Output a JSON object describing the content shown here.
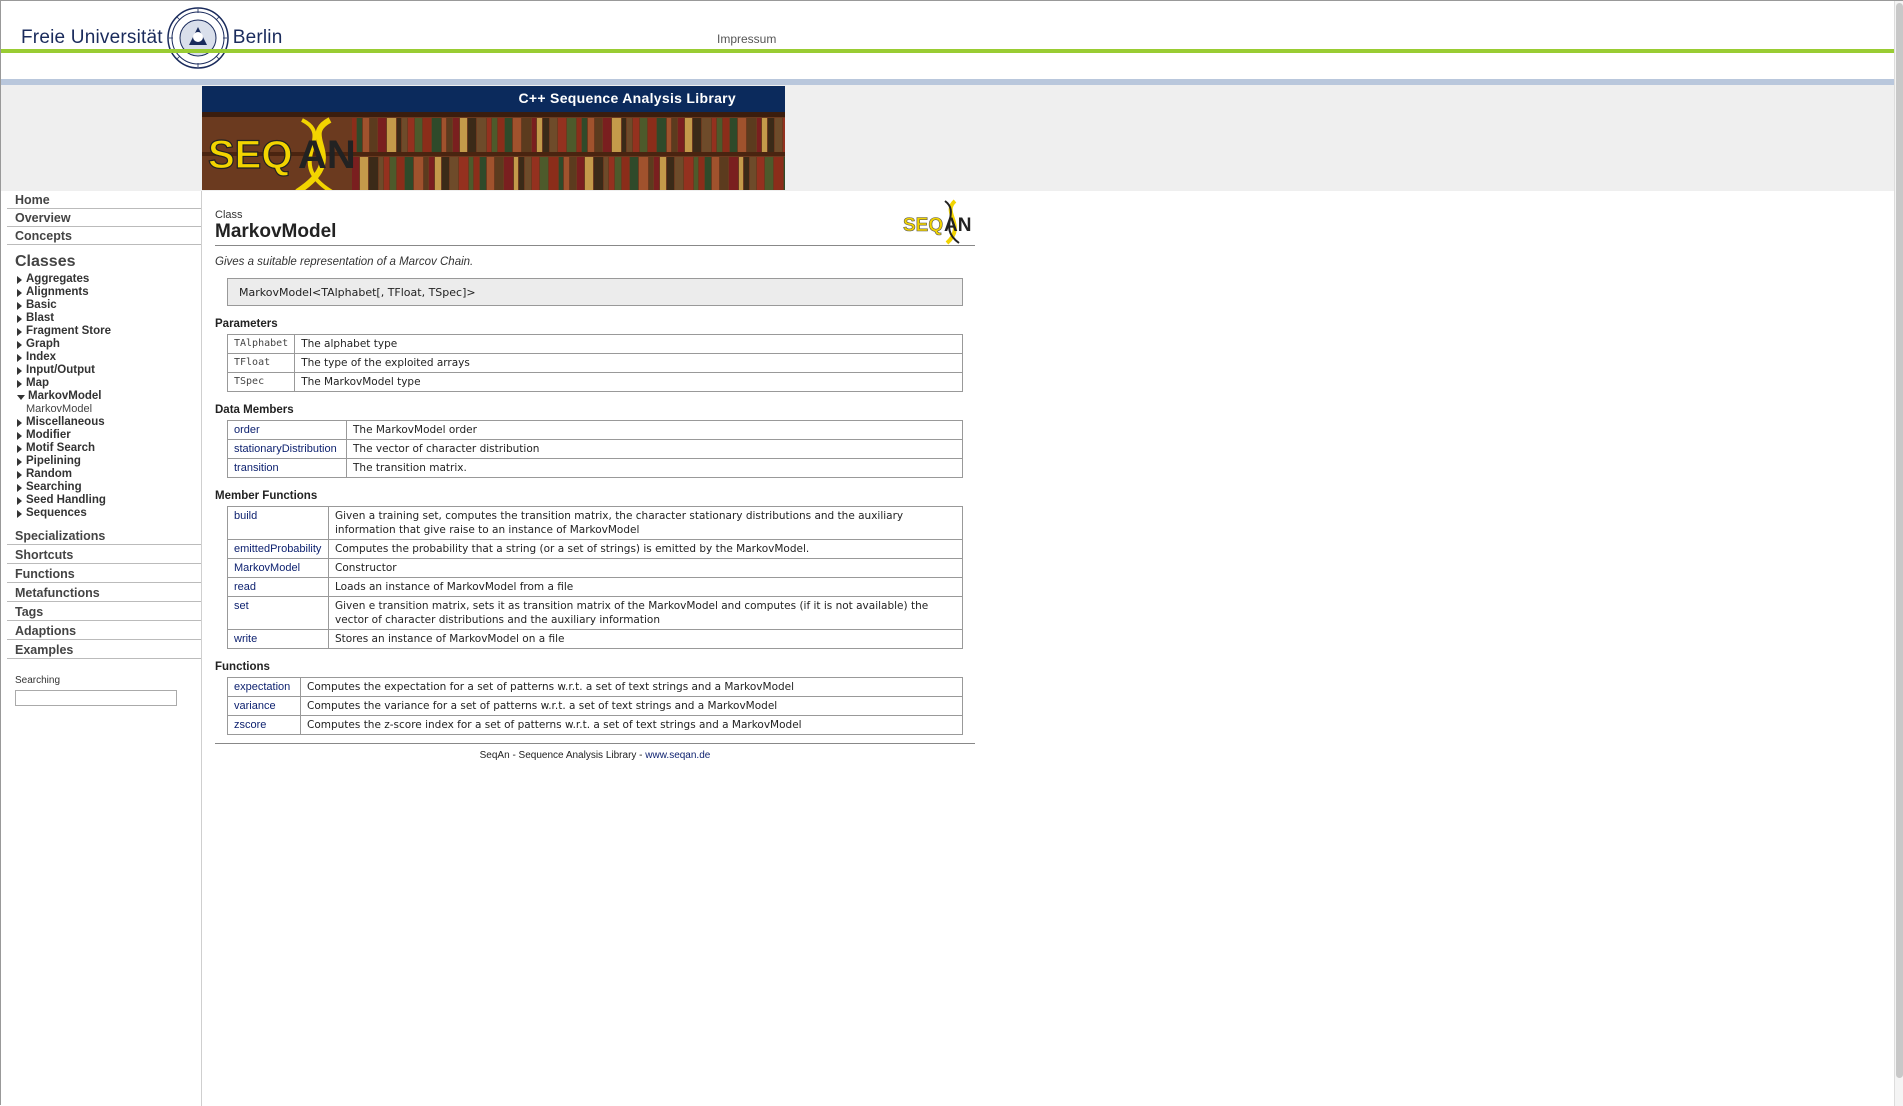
{
  "header": {
    "university_left": "Freie Universität",
    "university_right": "Berlin",
    "impressum": "Impressum"
  },
  "banner": {
    "title": "C++ Sequence Analysis Library",
    "logo_text": "SEQAN"
  },
  "sidebar": {
    "top_links": [
      "Home",
      "Overview",
      "Concepts"
    ],
    "classes_heading": "Classes",
    "classes": [
      {
        "label": "Aggregates",
        "expanded": false
      },
      {
        "label": "Alignments",
        "expanded": false
      },
      {
        "label": "Basic",
        "expanded": false
      },
      {
        "label": "Blast",
        "expanded": false
      },
      {
        "label": "Fragment Store",
        "expanded": false
      },
      {
        "label": "Graph",
        "expanded": false
      },
      {
        "label": "Index",
        "expanded": false
      },
      {
        "label": "Input/Output",
        "expanded": false
      },
      {
        "label": "Map",
        "expanded": false
      },
      {
        "label": "MarkovModel",
        "expanded": true,
        "children": [
          "MarkovModel"
        ]
      },
      {
        "label": "Miscellaneous",
        "expanded": false
      },
      {
        "label": "Modifier",
        "expanded": false
      },
      {
        "label": "Motif Search",
        "expanded": false
      },
      {
        "label": "Pipelining",
        "expanded": false
      },
      {
        "label": "Random",
        "expanded": false
      },
      {
        "label": "Searching",
        "expanded": false
      },
      {
        "label": "Seed Handling",
        "expanded": false
      },
      {
        "label": "Sequences",
        "expanded": false
      }
    ],
    "sections": [
      "Specializations",
      "Shortcuts",
      "Functions",
      "Metafunctions",
      "Tags",
      "Adaptions",
      "Examples"
    ],
    "search_label": "Searching",
    "search_value": ""
  },
  "main": {
    "kind": "Class",
    "title": "MarkovModel",
    "summary": "Gives a suitable representation of a Marcov Chain.",
    "signature": "MarkovModel<TAlphabet[, TFloat, TSpec]>",
    "parameters_heading": "Parameters",
    "parameters": [
      {
        "name": "TAlphabet",
        "desc": "The alphabet type"
      },
      {
        "name": "TFloat",
        "desc": "The type of the exploited arrays"
      },
      {
        "name": "TSpec",
        "desc": "The MarkovModel type"
      }
    ],
    "data_members_heading": "Data Members",
    "data_members": [
      {
        "name": "order",
        "desc": "The MarkovModel order"
      },
      {
        "name": "stationaryDistribution",
        "desc": "The vector of character distribution"
      },
      {
        "name": "transition",
        "desc": "The transition matrix."
      }
    ],
    "member_functions_heading": "Member Functions",
    "member_functions": [
      {
        "name": "build",
        "desc": "Given a training set, computes the transition matrix, the character stationary distributions and the auxiliary information that give raise to an instance of MarkovModel"
      },
      {
        "name": "emittedProbability",
        "desc": "Computes the probability that a string (or a set of strings) is emitted by the MarkovModel."
      },
      {
        "name": "MarkovModel",
        "desc": "Constructor"
      },
      {
        "name": "read",
        "desc": "Loads an instance of MarkovModel from a file"
      },
      {
        "name": "set",
        "desc": "Given e transition matrix, sets it as transition matrix of the MarkovModel and computes (if it is not available) the vector of character distributions and the auxiliary information"
      },
      {
        "name": "write",
        "desc": "Stores an instance of MarkovModel on a file"
      }
    ],
    "functions_heading": "Functions",
    "functions": [
      {
        "name": "expectation",
        "desc": "Computes the expectation for a set of patterns w.r.t. a set of text strings and a MarkovModel"
      },
      {
        "name": "variance",
        "desc": "Computes the variance for a set of patterns w.r.t. a set of text strings and a MarkovModel"
      },
      {
        "name": "zscore",
        "desc": "Computes the z-score index for a set of patterns w.r.t. a set of text strings and a MarkovModel"
      }
    ]
  },
  "footer": {
    "text": "SeqAn - Sequence Analysis Library - ",
    "link": "www.seqan.de"
  },
  "colors": {
    "green_rule": "#99cc33",
    "blue_rule": "#b9c7dc",
    "banner_navy": "#0b2a5c",
    "link": "#0b1f6e",
    "logo_yellow": "#f2d400"
  }
}
